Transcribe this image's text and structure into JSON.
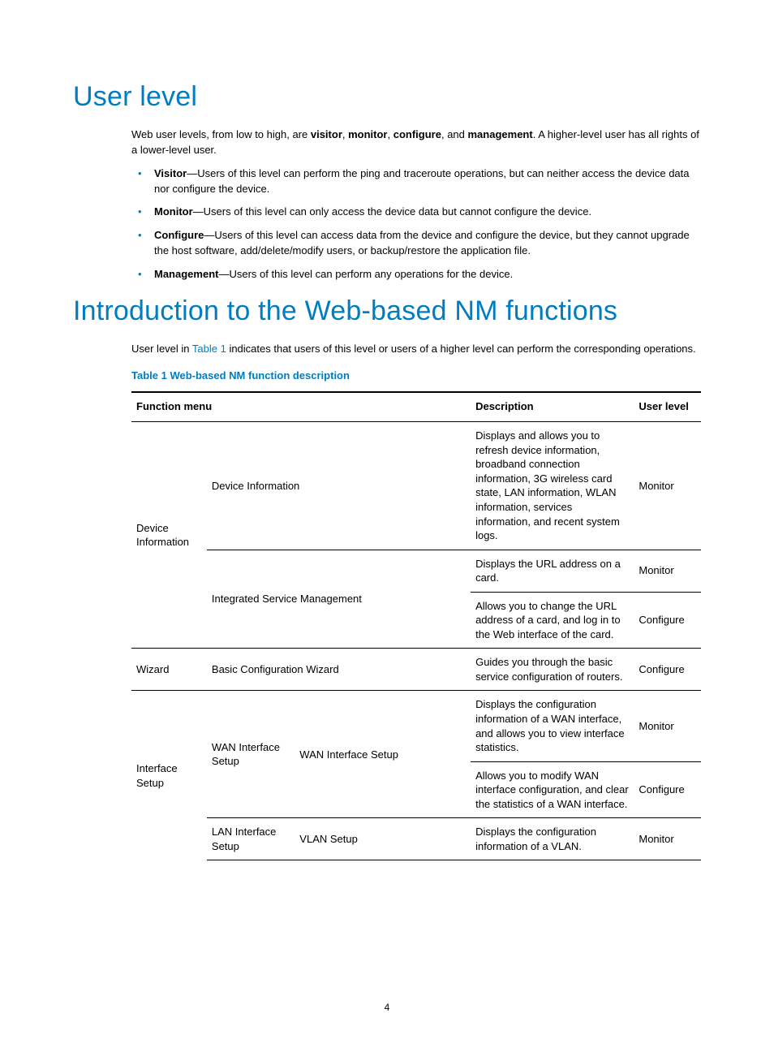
{
  "h1_user_level": "User level",
  "intro_para_parts": {
    "before": "Web user levels, from low to high, are ",
    "l1": "visitor",
    "c1": ", ",
    "l2": "monitor",
    "c2": ", ",
    "l3": "configure",
    "c3": ", and ",
    "l4": "management",
    "after": ". A higher-level user has all rights of a lower-level user."
  },
  "bullets": {
    "visitor": {
      "label": "Visitor",
      "text": "—Users of this level can perform the ping and traceroute operations, but can neither access the device data nor configure the device."
    },
    "monitor": {
      "label": "Monitor",
      "text": "—Users of this level can only access the device data but cannot configure the device."
    },
    "configure": {
      "label": "Configure",
      "text": "—Users of this level can access data from the device and configure the device, but they cannot upgrade the host software, add/delete/modify users, or backup/restore the application file."
    },
    "management": {
      "label": "Management",
      "text": "—Users of this level can perform any operations for the device."
    }
  },
  "h1_intro_nm": "Introduction to the Web-based NM functions",
  "nm_para": {
    "before": "User level in ",
    "xref": "Table 1",
    "after": " indicates that users of this level or users of a higher level can perform the corresponding operations."
  },
  "table_caption": "Table 1 Web-based NM function description",
  "table_headers": {
    "menu": "Function menu",
    "desc": "Description",
    "level": "User level"
  },
  "chart_data": {
    "type": "table",
    "columns": [
      "Function menu (L1)",
      "Function menu (L2)",
      "Function menu (L3)",
      "Description",
      "User level"
    ],
    "rows": [
      [
        "Device Information",
        "",
        "Device Information",
        "Displays and allows you to refresh device information, broadband connection information, 3G wireless card state, LAN information, WLAN information, services information, and recent system logs.",
        "Monitor"
      ],
      [
        "Device Information",
        "",
        "Integrated Service Management",
        "Displays the URL address on a card.",
        "Monitor"
      ],
      [
        "Device Information",
        "",
        "Integrated Service Management",
        "Allows you to change the URL address of a card, and log in to the Web interface of the card.",
        "Configure"
      ],
      [
        "Wizard",
        "Basic Configuration Wizard",
        "",
        "Guides you through the basic service configuration of routers.",
        "Configure"
      ],
      [
        "Interface Setup",
        "WAN Interface Setup",
        "WAN Interface Setup",
        "Displays the configuration information of a WAN interface, and allows you to view interface statistics.",
        "Monitor"
      ],
      [
        "Interface Setup",
        "WAN Interface Setup",
        "WAN Interface Setup",
        "Allows you to modify WAN interface configuration, and clear the statistics of a WAN interface.",
        "Configure"
      ],
      [
        "Interface Setup",
        "LAN Interface Setup",
        "VLAN Setup",
        "Displays the configuration information of a VLAN.",
        "Monitor"
      ]
    ]
  },
  "cells": {
    "dev_info_l1": "Device Information",
    "dev_info_l3a": "Device Information",
    "dev_info_desc1": "Displays and allows you to refresh device information, broadband connection information, 3G wireless card state, LAN information, WLAN information, services information, and recent system logs.",
    "dev_info_lvl1": "Monitor",
    "dev_info_l3b": "Integrated Service Management",
    "dev_info_desc2": "Displays the URL address on a card.",
    "dev_info_lvl2": "Monitor",
    "dev_info_desc3": "Allows you to change the URL address of a card, and log in to the Web interface of the card.",
    "dev_info_lvl3": "Configure",
    "wizard_l1": "Wizard",
    "wizard_l2": "Basic Configuration Wizard",
    "wizard_desc": "Guides you through the basic service configuration of routers.",
    "wizard_lvl": "Configure",
    "ifsetup_l1": "Interface Setup",
    "wan_l2": "WAN Interface Setup",
    "wan_l3": "WAN Interface Setup",
    "wan_desc1": "Displays the configuration information of a WAN interface, and allows you to view interface statistics.",
    "wan_lvl1": "Monitor",
    "wan_desc2": "Allows you to modify WAN interface configuration, and clear the statistics of a WAN interface.",
    "wan_lvl2": "Configure",
    "lan_l2": "LAN Interface Setup",
    "lan_l3": "VLAN Setup",
    "lan_desc": "Displays the configuration information of a VLAN.",
    "lan_lvl": "Monitor"
  },
  "page_number": "4"
}
